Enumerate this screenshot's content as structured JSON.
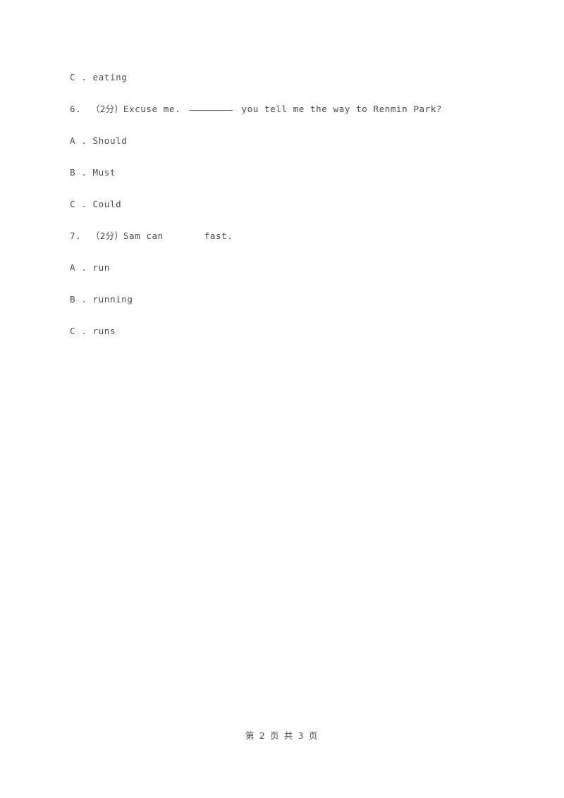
{
  "document": {
    "page_background": "#ffffff",
    "text_color": "#4d4d4d"
  },
  "body": {
    "lines": [
      {
        "kind": "option",
        "letter": "C",
        "separator": " . ",
        "text": "eating",
        "full": "C . eating"
      },
      {
        "kind": "question",
        "number": "6.",
        "score": "（2分）",
        "stem_before": "Excuse me. ",
        "blank_style": "underline-rule",
        "stem_after": " you tell me the way to Renmin Park?",
        "full": "6.   （2分）Excuse me. ________ you tell me the way to Renmin Park?"
      },
      {
        "kind": "option",
        "letter": "A",
        "separator": " . ",
        "text": "Should",
        "full": "A . Should"
      },
      {
        "kind": "option",
        "letter": "B",
        "separator": " . ",
        "text": "Must",
        "full": "B . Must"
      },
      {
        "kind": "option",
        "letter": "C",
        "separator": " . ",
        "text": "Could",
        "full": "C . Could"
      },
      {
        "kind": "question",
        "number": "7.",
        "score": "（2分）",
        "stem_before": "Sam can",
        "blank_style": "whitespace-gap",
        "stem_after": "fast.",
        "full": "7.   （2分）Sam can          fast."
      },
      {
        "kind": "option",
        "letter": "A",
        "separator": " . ",
        "text": "run",
        "full": "A . run"
      },
      {
        "kind": "option",
        "letter": "B",
        "separator": " . ",
        "text": "running",
        "full": "B . running"
      },
      {
        "kind": "option",
        "letter": "C",
        "separator": " . ",
        "text": "runs",
        "full": "C . runs"
      }
    ]
  },
  "footer": {
    "text": "第 2 页 共 3 页",
    "current_page": "2",
    "total_pages": "3"
  }
}
